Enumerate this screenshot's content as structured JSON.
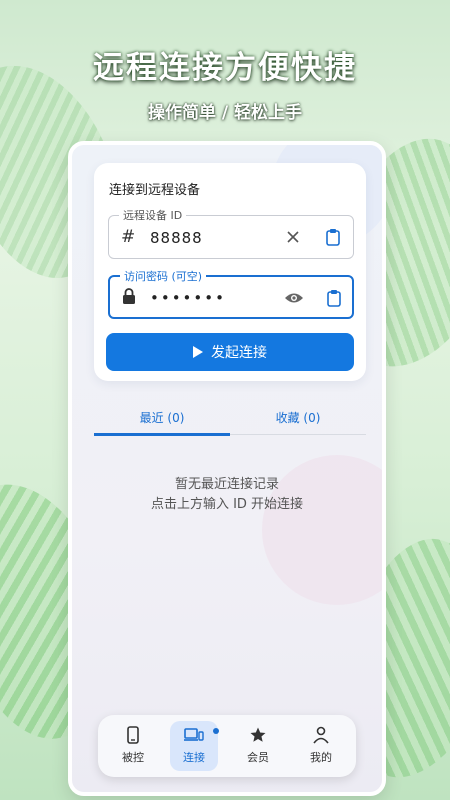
{
  "promo": {
    "headline": "远程连接方便快捷",
    "subline": "操作简单 / 轻松上手"
  },
  "card": {
    "title": "连接到远程设备",
    "device_id": {
      "label": "远程设备 ID",
      "prefix": "#",
      "value": "88888"
    },
    "password": {
      "label": "访问密码 (可空)",
      "value": "•••••••"
    },
    "connect_button": "发起连接"
  },
  "tabs": [
    {
      "label": "最近 (0)",
      "selected": true
    },
    {
      "label": "收藏 (0)",
      "selected": false
    }
  ],
  "empty_state": {
    "line1": "暂无最近连接记录",
    "line2": "点击上方输入 ID 开始连接"
  },
  "bottom_nav": [
    {
      "label": "被控",
      "icon": "phone-icon"
    },
    {
      "label": "连接",
      "icon": "devices-icon",
      "selected": true
    },
    {
      "label": "会员",
      "icon": "star-icon"
    },
    {
      "label": "我的",
      "icon": "person-icon"
    }
  ],
  "colors": {
    "accent": "#1478e0",
    "tab_active": "#1a6fd1"
  }
}
